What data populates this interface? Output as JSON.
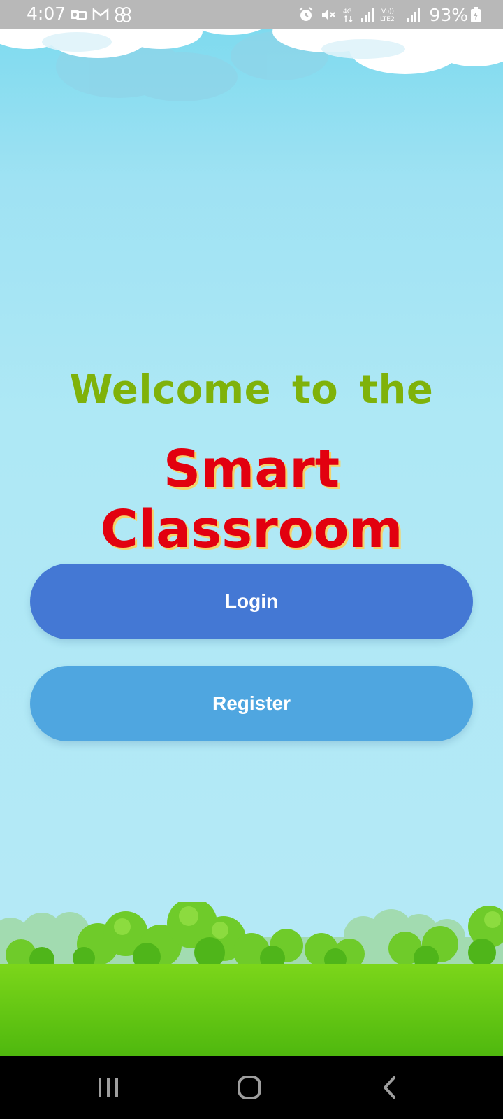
{
  "status_bar": {
    "time": "4:07",
    "battery": "93%",
    "left_icons": [
      "outlook-icon",
      "gmail-icon",
      "app-icon"
    ],
    "right_icons": [
      "alarm-icon",
      "mute-icon",
      "network-4g-icon",
      "signal-icon",
      "volte-icon",
      "signal-icon",
      "battery-charging-icon"
    ],
    "network_label": "4G",
    "volte_label_top": "Vo))",
    "volte_label_bottom": "LTE2"
  },
  "main": {
    "welcome_text": "Welcome to the",
    "app_title": "Smart Classroom",
    "login_label": "Login",
    "register_label": "Register"
  },
  "nav_bar": {
    "buttons": [
      "recents-icon",
      "home-icon",
      "back-icon"
    ]
  },
  "colors": {
    "welcome": "#7fb20a",
    "title": "#e2000f",
    "title_shadow": "#f5d36a",
    "login_button": "#4478d4",
    "register_button": "#4fa6e0",
    "sky": "#aee8f5",
    "grass": "#5cc412"
  }
}
